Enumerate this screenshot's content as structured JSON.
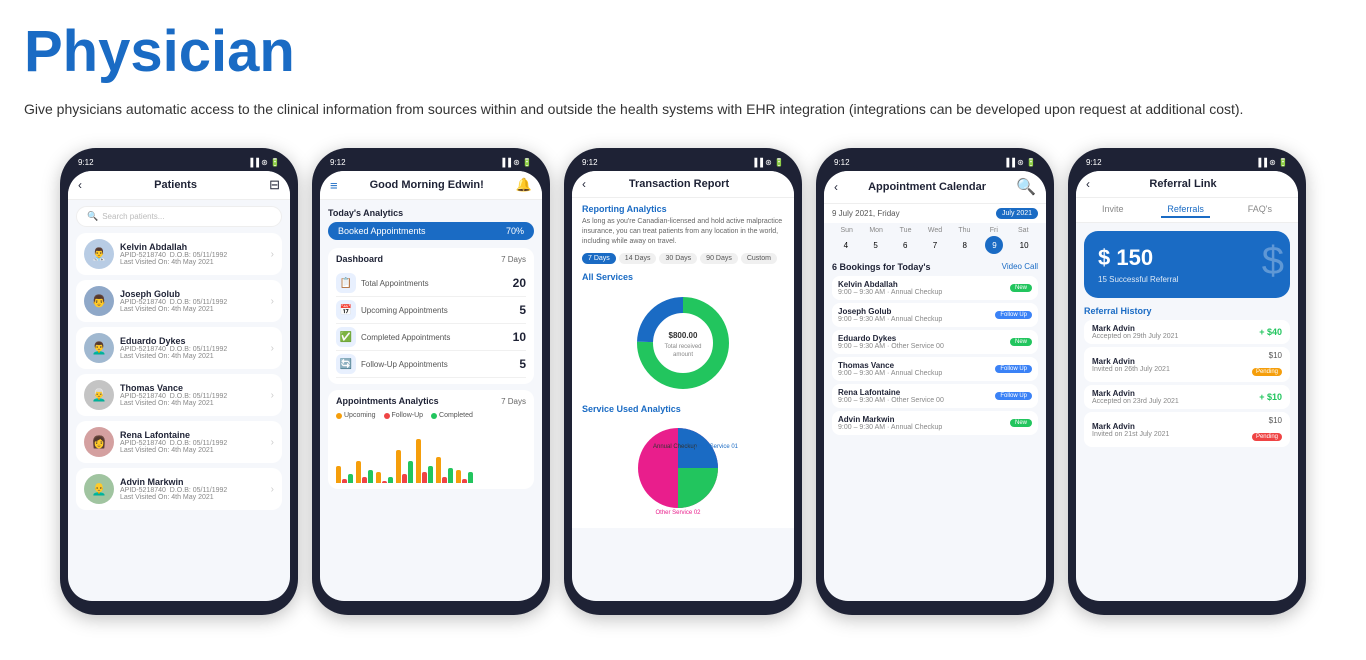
{
  "page": {
    "title": "Physician",
    "subtitle": "Give physicians automatic access to the clinical information from sources within and outside the health systems with EHR integration (integrations can be developed upon request at additional cost)."
  },
  "phone1": {
    "time": "9:12",
    "screen_title": "Patients",
    "search_placeholder": "Search patients...",
    "patients": [
      {
        "name": "Kelvin Abdallah",
        "id": "APID-5218740",
        "dob": "D.O.B: 05/11/1992",
        "last_visited": "Last Visited On: 4th May 2021",
        "avatar_color": "#b8cce4"
      },
      {
        "name": "Joseph Golub",
        "id": "APID-5218740",
        "dob": "D.O.B: 05/11/1992",
        "last_visited": "Last Visited On: 4th May 2021",
        "avatar_color": "#8fa8c8"
      },
      {
        "name": "Eduardo Dykes",
        "id": "APID-5218740",
        "dob": "D.O.B: 05/11/1992",
        "last_visited": "Last Visited On: 4th May 2021",
        "avatar_color": "#a0b8d0"
      },
      {
        "name": "Thomas Vance",
        "id": "APID-5218740",
        "dob": "D.O.B: 05/11/1992",
        "last_visited": "Last Visited On: 4th May 2021",
        "avatar_color": "#c4c4c4"
      },
      {
        "name": "Rena Lafontaine",
        "id": "APID-5218740",
        "dob": "D.O.B: 05/11/1992",
        "last_visited": "Last Visited On: 4th May 2021",
        "avatar_color": "#d4a0a0"
      },
      {
        "name": "Advin Markwin",
        "id": "APID-5218740",
        "dob": "D.O.B: 05/11/1992",
        "last_visited": "Last Visited On: 4th May 2021",
        "avatar_color": "#a0c4a0"
      }
    ]
  },
  "phone2": {
    "time": "9:12",
    "greeting": "Good Morning Edwin!",
    "analytics_label": "Today's Analytics",
    "booked_label": "Booked Appointments",
    "booked_percent": "70%",
    "dashboard_label": "Dashboard",
    "filter": "7 Days",
    "stats": [
      {
        "label": "Total Appointments",
        "value": "20",
        "icon": "📋"
      },
      {
        "label": "Upcoming Appointments",
        "value": "5",
        "icon": "📅"
      },
      {
        "label": "Completed Appointments",
        "value": "10",
        "icon": "✅"
      },
      {
        "label": "Follow-Up Appointments",
        "value": "5",
        "icon": "🔄"
      }
    ],
    "chart_title": "Appointments Analytics",
    "chart_filter": "7 Days",
    "legend": [
      {
        "label": "Upcoming",
        "color": "#f59e0b"
      },
      {
        "label": "Follow-Up",
        "color": "#ef4444"
      },
      {
        "label": "Completed",
        "color": "#22c55e"
      }
    ]
  },
  "phone3": {
    "time": "9:12",
    "screen_title": "Transaction Report",
    "reporting_title": "Reporting Analytics",
    "reporting_desc": "As long as you're Canadian-licensed and hold active malpractice insurance, you can treat patients from any location in the world, including while away on travel.",
    "filters": [
      "7 Days",
      "14 Days",
      "30 Days",
      "90 Days",
      "Custom"
    ],
    "active_filter": "7 Days",
    "all_services_title": "All Services",
    "service_analytics_title": "Service Used Analytics",
    "donut_center": "$800.00",
    "donut_label": "Total received amount"
  },
  "phone4": {
    "time": "9:12",
    "screen_title": "Appointment Calendar",
    "date_label": "9 July 2021, Friday",
    "month": "July 2021",
    "days_header": [
      "Sun",
      "Mon",
      "Tue",
      "Wed",
      "Thu",
      "Fri",
      "Sat"
    ],
    "calendar_days": [
      "4",
      "5",
      "6",
      "7",
      "8",
      "9",
      "10"
    ],
    "bookings_title": "6 Bookings for Today's",
    "video_call": "Video Call",
    "bookings": [
      {
        "name": "Kelvin Abdallah",
        "time": "9:00 – 9:30 AM · Annual Checkup",
        "badge": "New",
        "badge_type": "new"
      },
      {
        "name": "Joseph Golub",
        "time": "9:00 – 9:30 AM · Annual Checkup",
        "badge": "Follow Up",
        "badge_type": "followup"
      },
      {
        "name": "Eduardo Dykes",
        "time": "9:00 – 9:30 AM · Other Service 00",
        "badge": "New",
        "badge_type": "new"
      },
      {
        "name": "Thomas Vance",
        "time": "9:00 – 9:30 AM · Annual Checkup",
        "badge": "Follow Up",
        "badge_type": "followup"
      },
      {
        "name": "Rena Lafontaine",
        "time": "9:00 – 9:30 AM · Other Service 00",
        "badge": "Follow Up",
        "badge_type": "followup"
      },
      {
        "name": "Advin Markwin",
        "time": "9:00 – 9:30 AM · Annual Checkup",
        "badge": "New",
        "badge_type": "new"
      }
    ]
  },
  "phone5": {
    "time": "9:12",
    "screen_title": "Referral Link",
    "tabs": [
      "Invite",
      "Referrals",
      "FAQ's"
    ],
    "active_tab": "Referrals",
    "card_symbol": "$",
    "card_amount": "$ 150",
    "card_success": "15 Successful Referral",
    "history_title": "Referral History",
    "history": [
      {
        "name": "Mark Advin",
        "date": "Accepted on 29th July 2021",
        "amount": "+ $40",
        "amount_type": "positive"
      },
      {
        "name": "Mark Advin",
        "date": "Invited on 26th July 2021",
        "amount": "$10",
        "badge": "Pending",
        "badge_color": "#f59e0b"
      },
      {
        "name": "Mark Advin",
        "date": "Accepted on 23rd July 2021",
        "amount": "+ $10",
        "amount_type": "positive"
      },
      {
        "name": "Mark Advin",
        "date": "Invited on 21st July 2021",
        "amount": "$10",
        "badge": "Pending",
        "badge_color": "#ef4444"
      }
    ]
  }
}
